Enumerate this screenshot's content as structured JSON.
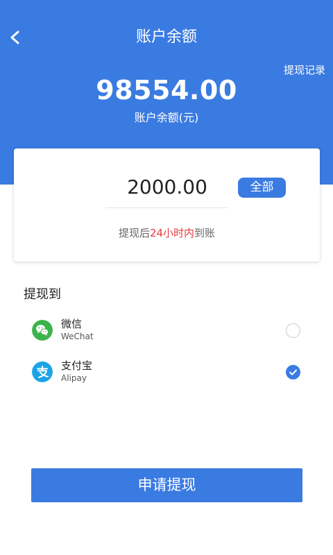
{
  "header": {
    "title": "账户余额",
    "record_link": "提现记录",
    "balance": "98554.00",
    "balance_label": "账户余额(元)",
    "back_icon": "chevron-left-icon"
  },
  "withdraw_card": {
    "amount": "2000.00",
    "all_button": "全部",
    "hint_prefix": "提现后",
    "hint_highlight": "24小时内",
    "hint_suffix": "到账"
  },
  "methods": {
    "title": "提现到",
    "items": [
      {
        "name": "微信",
        "sub": "WeChat",
        "icon": "wechat-icon",
        "selected": false
      },
      {
        "name": "支付宝",
        "sub": "Alipay",
        "icon": "alipay-icon",
        "selected": true
      }
    ]
  },
  "submit_button": "申请提现",
  "colors": {
    "primary": "#3a7be1",
    "highlight": "#e6393a",
    "wechat": "#3bb34a",
    "alipay": "#1aa3e6"
  }
}
